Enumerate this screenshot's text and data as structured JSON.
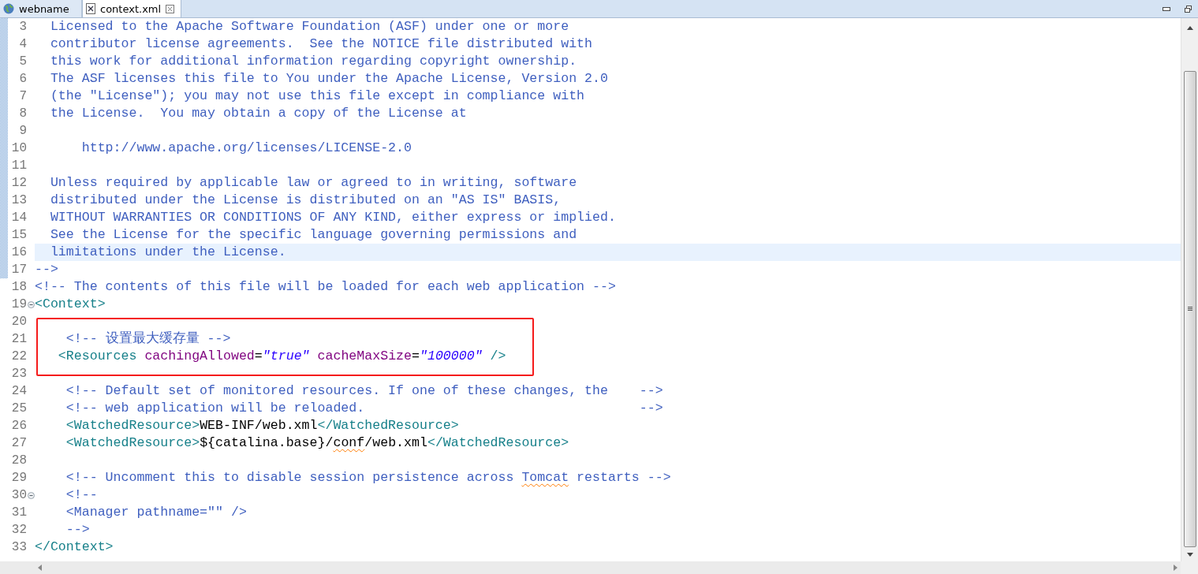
{
  "tabs": [
    {
      "label": "webname",
      "selected": false,
      "closable": false
    },
    {
      "label": "context.xml",
      "selected": true,
      "closable": true
    }
  ],
  "editor": {
    "lines": [
      {
        "number": "3",
        "changed": true,
        "tokens": [
          {
            "kind": "comment",
            "text": "  Licensed to the Apache Software Foundation (ASF) under one or more"
          }
        ]
      },
      {
        "number": "4",
        "changed": true,
        "tokens": [
          {
            "kind": "comment",
            "text": "  contributor license agreements.  See the NOTICE file distributed with"
          }
        ]
      },
      {
        "number": "5",
        "changed": true,
        "tokens": [
          {
            "kind": "comment",
            "text": "  this work for additional information regarding copyright ownership."
          }
        ]
      },
      {
        "number": "6",
        "changed": true,
        "tokens": [
          {
            "kind": "comment",
            "text": "  The ASF licenses this file to You under the Apache License, Version 2.0"
          }
        ]
      },
      {
        "number": "7",
        "changed": true,
        "tokens": [
          {
            "kind": "comment",
            "text": "  (the \"License\"); you may not use this file except in compliance with"
          }
        ]
      },
      {
        "number": "8",
        "changed": true,
        "tokens": [
          {
            "kind": "comment",
            "text": "  the License.  You may obtain a copy of the License at"
          }
        ]
      },
      {
        "number": "9",
        "changed": true
      },
      {
        "number": "10",
        "changed": true,
        "tokens": [
          {
            "kind": "comment",
            "text": "      http://www.apache.org/licenses/LICENSE-2.0"
          }
        ]
      },
      {
        "number": "11",
        "changed": true
      },
      {
        "number": "12",
        "changed": true,
        "tokens": [
          {
            "kind": "comment",
            "text": "  Unless required by applicable law or agreed to in writing, software"
          }
        ]
      },
      {
        "number": "13",
        "changed": true,
        "tokens": [
          {
            "kind": "comment",
            "text": "  distributed under the License is distributed on an \"AS IS\" BASIS,"
          }
        ]
      },
      {
        "number": "14",
        "changed": true,
        "tokens": [
          {
            "kind": "comment",
            "text": "  WITHOUT WARRANTIES OR CONDITIONS OF ANY KIND, either express or implied."
          }
        ]
      },
      {
        "number": "15",
        "changed": true,
        "tokens": [
          {
            "kind": "comment",
            "text": "  See the License for the specific language governing permissions and"
          }
        ]
      },
      {
        "number": "16",
        "changed": true,
        "current": true,
        "tokens": [
          {
            "kind": "comment",
            "text": "  limitations under the License."
          }
        ]
      },
      {
        "number": "17",
        "changed": true,
        "tokens": [
          {
            "kind": "comment",
            "text": "-->"
          }
        ]
      },
      {
        "number": "18",
        "tokens": [
          {
            "kind": "comment",
            "text": "<!-- The contents of this file will be loaded for each web application -->"
          }
        ]
      },
      {
        "number": "19",
        "foldable": true,
        "tokens": [
          {
            "kind": "tag",
            "text": "<Context>"
          }
        ]
      },
      {
        "number": "20"
      },
      {
        "number": "21",
        "boxed": true,
        "tokens": [
          {
            "kind": "comment",
            "text": "    <!-- 设置最大缓存量 -->"
          }
        ]
      },
      {
        "number": "22",
        "boxed": true,
        "tokens": [
          {
            "kind": "tag",
            "text": "   <Resources"
          },
          {
            "kind": "attr",
            "text": " cachingAllowed"
          },
          {
            "kind": "text",
            "text": "="
          },
          {
            "kind": "value",
            "text": "\"true\""
          },
          {
            "kind": "attr",
            "text": " cacheMaxSize"
          },
          {
            "kind": "text",
            "text": "="
          },
          {
            "kind": "value",
            "text": "\"100000\""
          },
          {
            "kind": "tag",
            "text": " />"
          }
        ]
      },
      {
        "number": "23"
      },
      {
        "number": "24",
        "tokens": [
          {
            "kind": "comment",
            "text": "    <!-- Default set of monitored resources. If one of these changes, the    -->"
          }
        ]
      },
      {
        "number": "25",
        "tokens": [
          {
            "kind": "comment",
            "text": "    <!-- web application will be reloaded.                                   -->"
          }
        ]
      },
      {
        "number": "26",
        "tokens": [
          {
            "kind": "tag",
            "text": "    <WatchedResource>"
          },
          {
            "kind": "text",
            "text": "WEB-INF/web.xml"
          },
          {
            "kind": "tag",
            "text": "</WatchedResource>"
          }
        ]
      },
      {
        "number": "27",
        "tokens": [
          {
            "kind": "tag",
            "text": "    <WatchedResource>"
          },
          {
            "kind": "text",
            "text": "${catalina.base}/"
          },
          {
            "kind": "text",
            "text": "conf",
            "misspelled": true
          },
          {
            "kind": "text",
            "text": "/web.xml"
          },
          {
            "kind": "tag",
            "text": "</WatchedResource>"
          }
        ]
      },
      {
        "number": "28"
      },
      {
        "number": "29",
        "tokens": [
          {
            "kind": "comment",
            "text": "    <!-- Uncomment this to disable session persistence across "
          },
          {
            "kind": "comment",
            "text": "Tomcat",
            "misspelled": true
          },
          {
            "kind": "comment",
            "text": " restarts -->"
          }
        ]
      },
      {
        "number": "30",
        "foldable": true,
        "tokens": [
          {
            "kind": "comment",
            "text": "    <!--"
          }
        ]
      },
      {
        "number": "31",
        "tokens": [
          {
            "kind": "comment",
            "text": "    <Manager pathname=\"\" />"
          }
        ]
      },
      {
        "number": "32",
        "tokens": [
          {
            "kind": "comment",
            "text": "    -->"
          }
        ]
      },
      {
        "number": "33",
        "tokens": [
          {
            "kind": "tag",
            "text": "</Context>"
          }
        ]
      }
    ]
  }
}
